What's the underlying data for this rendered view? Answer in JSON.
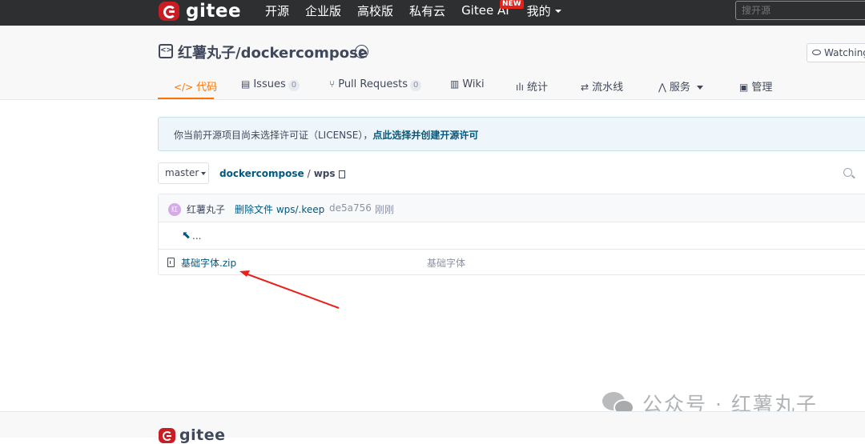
{
  "topnav": {
    "logo_text": "gitee",
    "links": [
      "开源",
      "企业版",
      "高校版",
      "私有云",
      "Gitee AI",
      "我的"
    ],
    "new_badge": "NEW",
    "search_placeholder": "搜开源"
  },
  "repo": {
    "icon_glyph": "<>",
    "title": "红薯丸子/dockercompose",
    "watch_label": "Watching"
  },
  "tabs": [
    {
      "icon": "</>",
      "label": "代码"
    },
    {
      "icon": "▤",
      "label": "Issues",
      "count": "0"
    },
    {
      "icon": "⑂",
      "label": "Pull Requests",
      "count": "0"
    },
    {
      "icon": "▥",
      "label": "Wiki"
    },
    {
      "icon": "ılı",
      "label": "统计"
    },
    {
      "icon": "⇄",
      "label": "流水线"
    },
    {
      "icon": "⋀",
      "label": "服务"
    },
    {
      "icon": "▣",
      "label": "管理"
    }
  ],
  "notice": {
    "text": "你当前开源项目尚未选择许可证（LICENSE），",
    "link": "点此选择并创建开源许可"
  },
  "branch": "master",
  "breadcrumb": {
    "repo": "dockercompose",
    "sep": "/",
    "dir": "wps"
  },
  "commit": {
    "avatar_text": "红",
    "author": "红薯丸子",
    "message": "删除文件 wps/.keep",
    "sha": "de5a756",
    "time": "刚刚"
  },
  "up_dir": "...",
  "up_icon": "⬉",
  "files": [
    {
      "name": "基础字体.zip",
      "message": "基础字体"
    }
  ],
  "footer": {
    "logo_text": "gitee"
  },
  "watermark": {
    "text": "公众号 · 红薯丸子"
  },
  "colors": {
    "brand": "#c71d23",
    "accent": "#fe7300",
    "link": "#005980",
    "annotation_arrow": "#e8221b"
  }
}
